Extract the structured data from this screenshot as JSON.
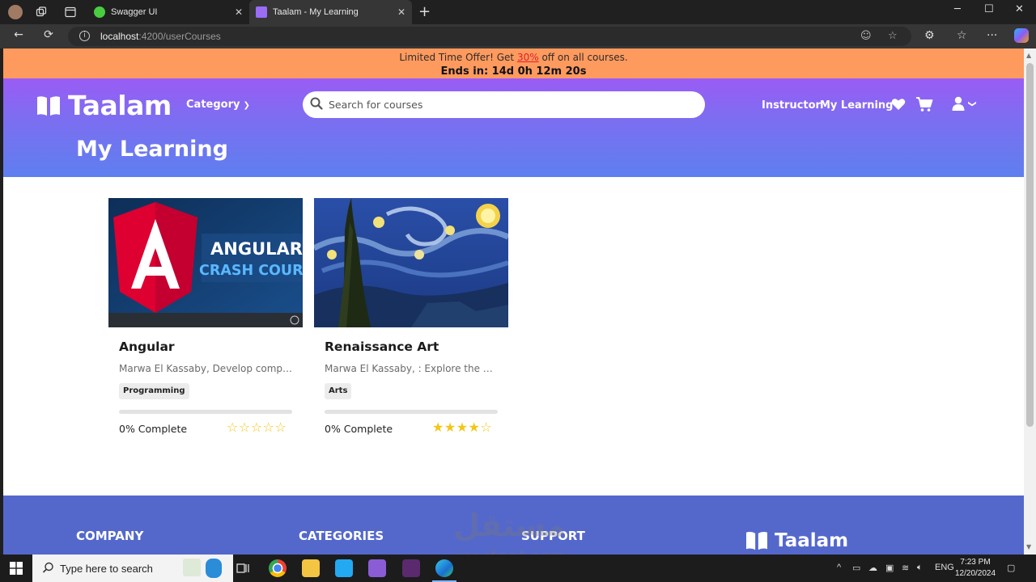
{
  "browser": {
    "tabs": [
      {
        "label": "Swagger UI"
      },
      {
        "label": "Taalam - My Learning"
      }
    ],
    "url_host": "localhost",
    "url_path": ":4200/userCourses"
  },
  "promo": {
    "text_before": "Limited Time Offer! Get ",
    "percent": "30%",
    "text_after": " off on all courses.",
    "countdown": "Ends in: 14d 0h 12m 20s"
  },
  "header": {
    "brand": "Taalam",
    "category_label": "Category",
    "search_placeholder": "Search for courses",
    "nav_instructor": "Instructor",
    "nav_my_learning": "My Learning",
    "page_title": "My Learning"
  },
  "courses": [
    {
      "title": "Angular",
      "description": "Marwa El Kassaby, Develop compr...",
      "category": "Programming",
      "progress_text": "0% Complete",
      "progress": 0,
      "rating": 0,
      "thumbnail_text": [
        "ANGULAR",
        "CRASH COURSE"
      ]
    },
    {
      "title": "Renaissance Art",
      "description": "Marwa El Kassaby, : Explore the m...",
      "category": "Arts",
      "progress_text": "0% Complete",
      "progress": 0,
      "rating": 4
    }
  ],
  "footer": {
    "company": "COMPANY",
    "categories": "CATEGORIES",
    "support": "SUPPORT",
    "brand": "Taalam"
  },
  "watermark": {
    "arabic": "مستقل",
    "latin": "mostaql.com"
  },
  "taskbar": {
    "search_placeholder": "Type here to search",
    "language": "ENG",
    "time": "7:23 PM",
    "date": "12/20/2024"
  },
  "colors": {
    "promo_bg": "#ff9a5e",
    "hero_top": "#9a5cf5",
    "hero_bottom": "#5e7ff0",
    "footer_bg": "#5468cc",
    "star": "#f5c518"
  }
}
